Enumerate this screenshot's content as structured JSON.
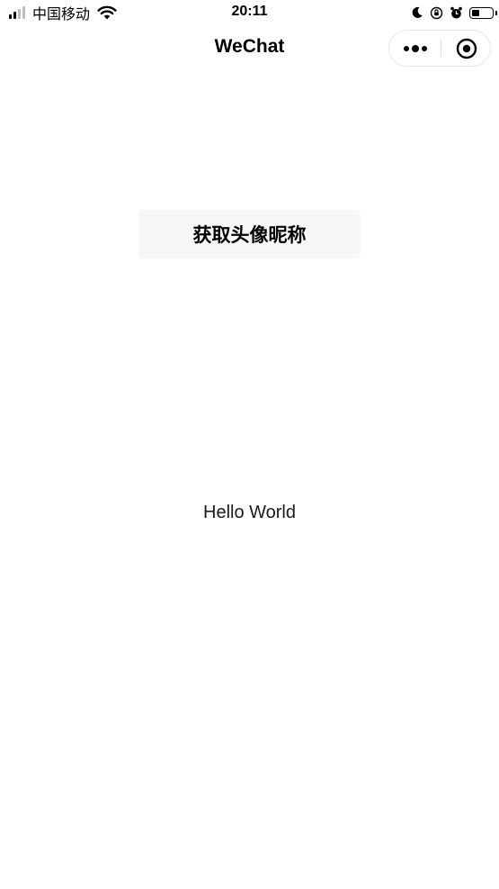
{
  "status_bar": {
    "carrier": "中国移动",
    "time": "20:11",
    "signal_bars_active": 2,
    "signal_bars_total": 4,
    "battery_level": 0.4,
    "icons": [
      "signal-icon",
      "wifi-icon",
      "moon-icon",
      "orientation-lock-icon",
      "alarm-icon",
      "battery-icon"
    ]
  },
  "nav": {
    "title": "WeChat",
    "capsule": {
      "more_icon": "more-dots-icon",
      "close_icon": "close-circle-icon"
    }
  },
  "main": {
    "avatar_button_label": "获取头像昵称",
    "hello_text": "Hello World"
  },
  "colors": {
    "background": "#ffffff",
    "button_background": "#f7f7f7",
    "text": "#000000",
    "signal_inactive": "#bdbdbd"
  }
}
